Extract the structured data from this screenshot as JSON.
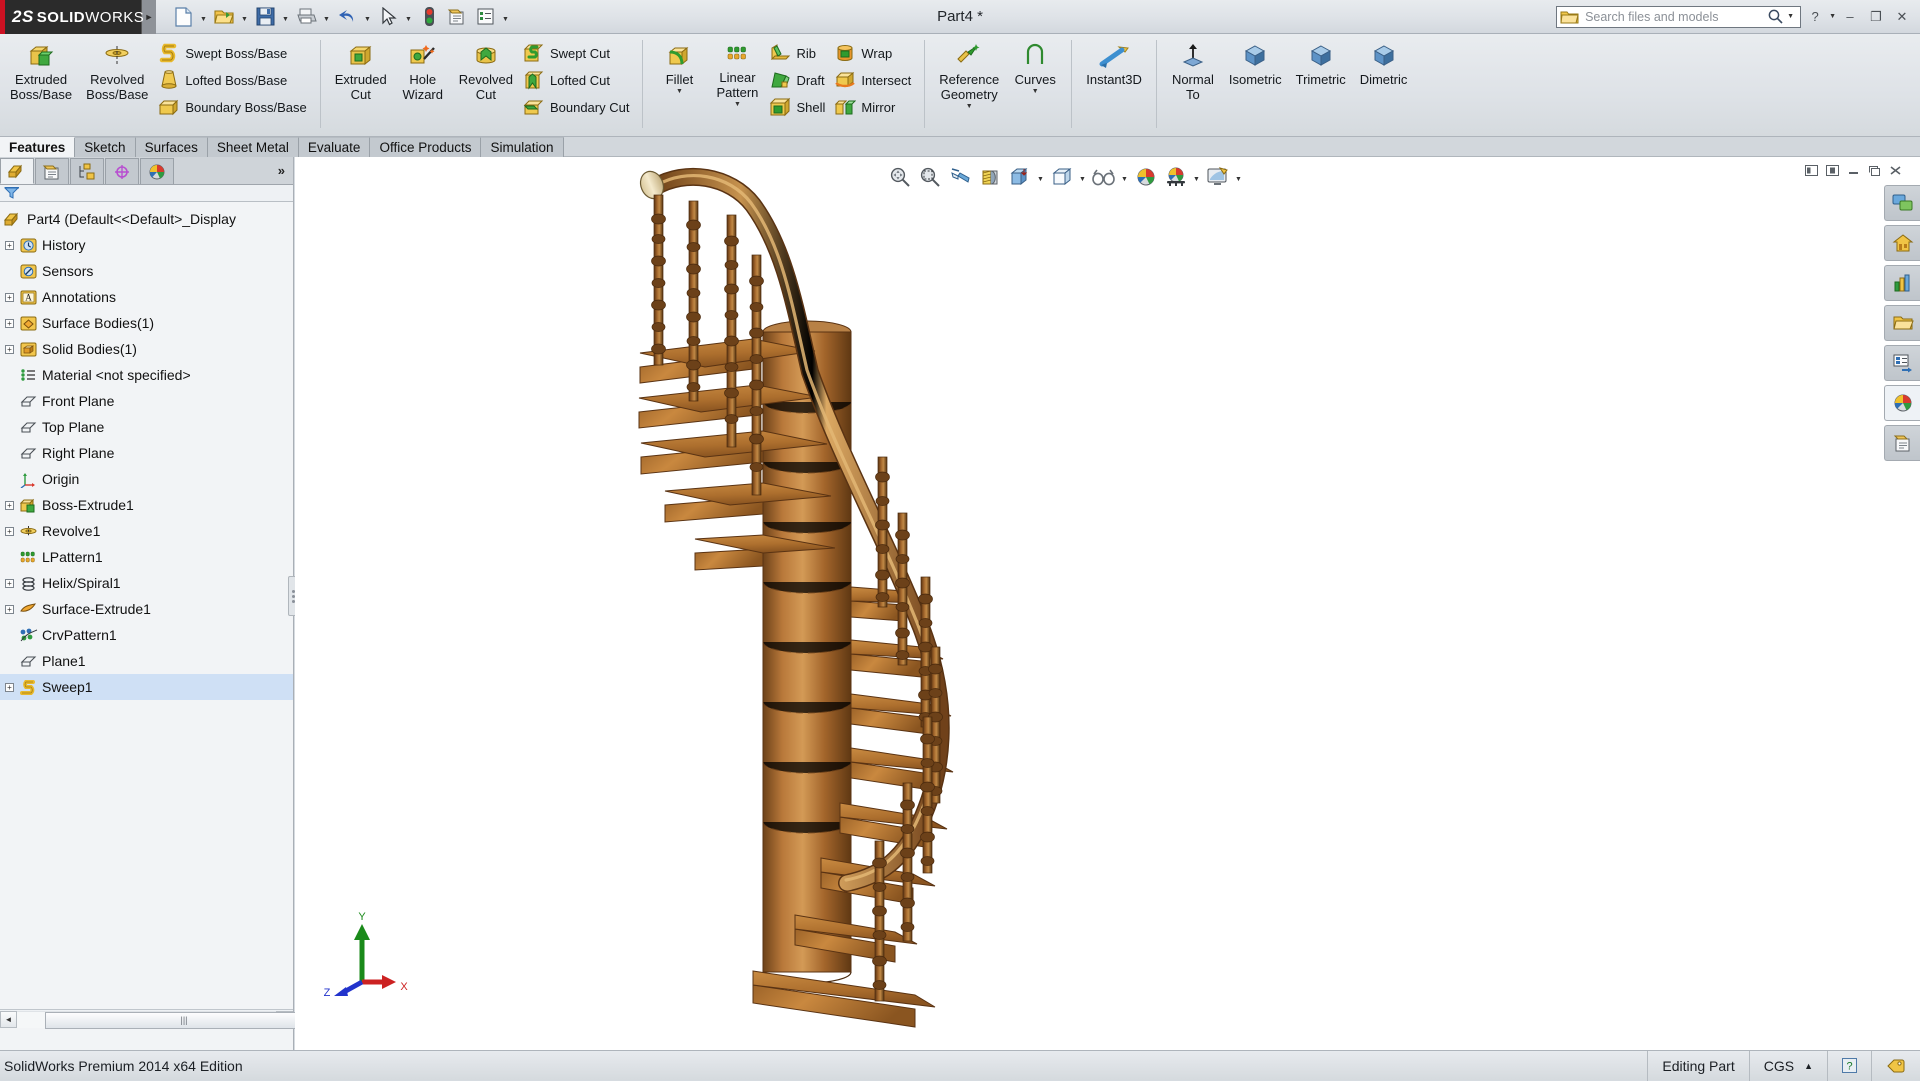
{
  "window": {
    "app_name_ds": "2S",
    "app_name_solid": "SOLID",
    "app_name_works": "WORKS",
    "document_title": "Part4 *",
    "search_placeholder": "Search files and models",
    "minimize_label": "–",
    "restore_label": "❐",
    "close_label": "✕",
    "help_label": "?"
  },
  "quick_access": [
    {
      "name": "new-document",
      "icon": "new-doc-icon",
      "has_dropdown": true
    },
    {
      "name": "open-document",
      "icon": "open-folder-icon",
      "has_dropdown": true
    },
    {
      "name": "save-document",
      "icon": "save-floppy-icon",
      "has_dropdown": true
    },
    {
      "name": "print-document",
      "icon": "printer-icon",
      "has_dropdown": true
    },
    {
      "name": "undo",
      "icon": "undo-arrow-icon",
      "has_dropdown": true
    },
    {
      "name": "select",
      "icon": "cursor-arrow-icon",
      "has_dropdown": true
    },
    {
      "name": "rebuild",
      "icon": "traffic-light-icon",
      "has_dropdown": false
    },
    {
      "name": "file-properties",
      "icon": "properties-icon",
      "has_dropdown": false
    },
    {
      "name": "options",
      "icon": "options-list-icon",
      "has_dropdown": true
    }
  ],
  "ribbon": {
    "groups": [
      {
        "id": "boss-base",
        "big": [
          {
            "label_lines": [
              "Extruded",
              "Boss/Base"
            ],
            "icon": "extruded-boss-icon",
            "name": "extruded-boss-base-button"
          },
          {
            "label_lines": [
              "Revolved",
              "Boss/Base"
            ],
            "icon": "revolved-boss-icon",
            "name": "revolved-boss-base-button"
          }
        ],
        "small": [
          {
            "label": "Swept Boss/Base",
            "icon": "swept-boss-icon",
            "name": "swept-boss-base-button"
          },
          {
            "label": "Lofted Boss/Base",
            "icon": "lofted-boss-icon",
            "name": "lofted-boss-base-button"
          },
          {
            "label": "Boundary Boss/Base",
            "icon": "boundary-boss-icon",
            "name": "boundary-boss-base-button"
          }
        ]
      },
      {
        "id": "cut",
        "big": [
          {
            "label_lines": [
              "Extruded",
              "Cut"
            ],
            "icon": "extruded-cut-icon",
            "name": "extruded-cut-button"
          },
          {
            "label_lines": [
              "Hole",
              "Wizard"
            ],
            "icon": "hole-wizard-icon",
            "name": "hole-wizard-button"
          },
          {
            "label_lines": [
              "Revolved",
              "Cut"
            ],
            "icon": "revolved-cut-icon",
            "name": "revolved-cut-button"
          }
        ],
        "small": [
          {
            "label": "Swept Cut",
            "icon": "swept-cut-icon",
            "name": "swept-cut-button"
          },
          {
            "label": "Lofted Cut",
            "icon": "lofted-cut-icon",
            "name": "lofted-cut-button"
          },
          {
            "label": "Boundary Cut",
            "icon": "boundary-cut-icon",
            "name": "boundary-cut-button"
          }
        ]
      },
      {
        "id": "features",
        "big": [
          {
            "label_lines": [
              "Fillet"
            ],
            "icon": "fillet-icon",
            "name": "fillet-button",
            "caret": true
          },
          {
            "label_lines": [
              "Linear",
              "Pattern"
            ],
            "icon": "linear-pattern-icon",
            "name": "linear-pattern-button",
            "caret": true
          }
        ],
        "small": [
          {
            "label": "Rib",
            "icon": "rib-icon",
            "name": "rib-button"
          },
          {
            "label": "Draft",
            "icon": "draft-icon",
            "name": "draft-button"
          },
          {
            "label": "Shell",
            "icon": "shell-icon",
            "name": "shell-button"
          }
        ],
        "small2": [
          {
            "label": "Wrap",
            "icon": "wrap-icon",
            "name": "wrap-button"
          },
          {
            "label": "Intersect",
            "icon": "intersect-icon",
            "name": "intersect-button"
          },
          {
            "label": "Mirror",
            "icon": "mirror-icon",
            "name": "mirror-button"
          }
        ]
      },
      {
        "id": "reference",
        "big": [
          {
            "label_lines": [
              "Reference",
              "Geometry"
            ],
            "icon": "reference-geometry-icon",
            "name": "reference-geometry-button",
            "caret": true
          },
          {
            "label_lines": [
              "Curves"
            ],
            "icon": "curves-icon",
            "name": "curves-button",
            "caret": true
          }
        ]
      },
      {
        "id": "instant3d",
        "big": [
          {
            "label_lines": [
              "Instant3D"
            ],
            "icon": "instant3d-icon",
            "name": "instant3d-button"
          }
        ]
      },
      {
        "id": "views",
        "big": [
          {
            "label_lines": [
              "Normal",
              "To"
            ],
            "icon": "normal-to-icon",
            "name": "normal-to-button"
          },
          {
            "label_lines": [
              "Isometric"
            ],
            "icon": "isometric-cube-icon",
            "name": "isometric-button"
          },
          {
            "label_lines": [
              "Trimetric"
            ],
            "icon": "trimetric-cube-icon",
            "name": "trimetric-button"
          },
          {
            "label_lines": [
              "Dimetric"
            ],
            "icon": "dimetric-cube-icon",
            "name": "dimetric-button"
          }
        ]
      }
    ]
  },
  "command_tabs": [
    {
      "label": "Features",
      "active": true
    },
    {
      "label": "Sketch",
      "active": false
    },
    {
      "label": "Surfaces",
      "active": false
    },
    {
      "label": "Sheet Metal",
      "active": false
    },
    {
      "label": "Evaluate",
      "active": false
    },
    {
      "label": "Office Products",
      "active": false
    },
    {
      "label": "Simulation",
      "active": false
    }
  ],
  "feature_manager": {
    "panel_tabs": [
      {
        "name": "feature-manager-tab",
        "icon": "feature-tree-icon",
        "active": true
      },
      {
        "name": "property-manager-tab",
        "icon": "property-manager-icon",
        "active": false
      },
      {
        "name": "configuration-manager-tab",
        "icon": "configuration-icon",
        "active": false
      },
      {
        "name": "dimxpert-manager-tab",
        "icon": "dimxpert-icon",
        "active": false
      },
      {
        "name": "display-manager-tab",
        "icon": "display-manager-icon",
        "active": false
      }
    ],
    "more_tabs_label": "»",
    "filter_icon": "filter-funnel-icon",
    "tree": [
      {
        "label": "Part4  (Default<<Default>_Display",
        "icon": "part-icon",
        "expandable": false,
        "level": 0
      },
      {
        "label": "History",
        "icon": "history-clock-icon",
        "expandable": true,
        "level": 1
      },
      {
        "label": "Sensors",
        "icon": "sensors-icon",
        "expandable": false,
        "level": 1
      },
      {
        "label": "Annotations",
        "icon": "annotations-icon",
        "expandable": true,
        "level": 1
      },
      {
        "label": "Surface Bodies(1)",
        "icon": "surface-bodies-icon",
        "expandable": true,
        "level": 1
      },
      {
        "label": "Solid Bodies(1)",
        "icon": "solid-bodies-icon",
        "expandable": true,
        "level": 1
      },
      {
        "label": "Material <not specified>",
        "icon": "material-icon",
        "expandable": false,
        "level": 1
      },
      {
        "label": "Front Plane",
        "icon": "plane-icon",
        "expandable": false,
        "level": 1
      },
      {
        "label": "Top Plane",
        "icon": "plane-icon",
        "expandable": false,
        "level": 1
      },
      {
        "label": "Right Plane",
        "icon": "plane-icon",
        "expandable": false,
        "level": 1
      },
      {
        "label": "Origin",
        "icon": "origin-icon",
        "expandable": false,
        "level": 1
      },
      {
        "label": "Boss-Extrude1",
        "icon": "boss-extrude-icon",
        "expandable": true,
        "level": 1
      },
      {
        "label": "Revolve1",
        "icon": "revolve-icon",
        "expandable": true,
        "level": 1
      },
      {
        "label": "LPattern1",
        "icon": "linear-pattern-icon",
        "expandable": false,
        "level": 1
      },
      {
        "label": "Helix/Spiral1",
        "icon": "helix-spiral-icon",
        "expandable": true,
        "level": 1
      },
      {
        "label": "Surface-Extrude1",
        "icon": "surface-extrude-icon",
        "expandable": true,
        "level": 1
      },
      {
        "label": "CrvPattern1",
        "icon": "curve-pattern-icon",
        "expandable": false,
        "level": 1
      },
      {
        "label": "Plane1",
        "icon": "plane-icon",
        "expandable": false,
        "level": 1
      },
      {
        "label": "Sweep1",
        "icon": "sweep-icon",
        "expandable": true,
        "level": 1,
        "selected": true
      }
    ],
    "hscroll": {
      "left_arrow": "◄",
      "right_arrow": "►",
      "grip": "|||"
    }
  },
  "view_toolbar": [
    {
      "name": "zoom-to-fit-button",
      "icon": "zoom-to-fit-icon",
      "dropdown": false
    },
    {
      "name": "zoom-to-area-button",
      "icon": "zoom-to-area-icon",
      "dropdown": false
    },
    {
      "name": "previous-view-button",
      "icon": "previous-view-icon",
      "dropdown": false
    },
    {
      "name": "section-view-button",
      "icon": "section-view-icon",
      "dropdown": false
    },
    {
      "name": "view-orientation-button",
      "icon": "view-orientation-icon",
      "dropdown": true
    },
    {
      "name": "display-style-button",
      "icon": "display-style-icon",
      "dropdown": true
    },
    {
      "name": "hide-show-items-button",
      "icon": "glasses-icon",
      "dropdown": true
    },
    {
      "name": "edit-appearance-button",
      "icon": "appearance-sphere-icon",
      "dropdown": false
    },
    {
      "name": "apply-scene-button",
      "icon": "scene-icon",
      "dropdown": true
    },
    {
      "name": "view-settings-button",
      "icon": "view-settings-icon",
      "dropdown": true
    }
  ],
  "graphics_window_buttons": [
    {
      "name": "tile-horizontal-button",
      "glyph": "⌸"
    },
    {
      "name": "tile-vertical-button",
      "glyph": "▣"
    },
    {
      "name": "minimize-doc-button",
      "glyph": "–"
    },
    {
      "name": "restore-doc-button",
      "glyph": "❐"
    },
    {
      "name": "close-doc-button",
      "glyph": "✕"
    }
  ],
  "task_pane": [
    {
      "name": "solidworks-resources-button",
      "icon": "resources-icon"
    },
    {
      "name": "design-library-button",
      "icon": "home-library-icon"
    },
    {
      "name": "file-explorer-button",
      "icon": "chart-explorer-icon"
    },
    {
      "name": "search-folder-button",
      "icon": "folder-icon"
    },
    {
      "name": "view-palette-button",
      "icon": "view-palette-icon"
    },
    {
      "name": "appearances-scenes-button",
      "icon": "appearances-sphere-icon",
      "active": true
    },
    {
      "name": "custom-properties-button",
      "icon": "custom-properties-icon"
    }
  ],
  "triad": {
    "x_label": "X",
    "y_label": "Y",
    "z_label": "Z"
  },
  "status_bar": {
    "left_text": "SolidWorks Premium 2014 x64 Edition",
    "editing_state": "Editing Part",
    "units": "CGS",
    "units_caret": "▲",
    "help_glyph": "?",
    "tag_icon": "tag-icon"
  },
  "model": {
    "description": "spiral staircase 3D model",
    "wood_light": "#c8893f",
    "wood_mid": "#9a5f25",
    "wood_dark": "#6d3f16",
    "wood_tread": "#b97b38",
    "rail_light": "#d79a50",
    "background": "#ffffff"
  }
}
